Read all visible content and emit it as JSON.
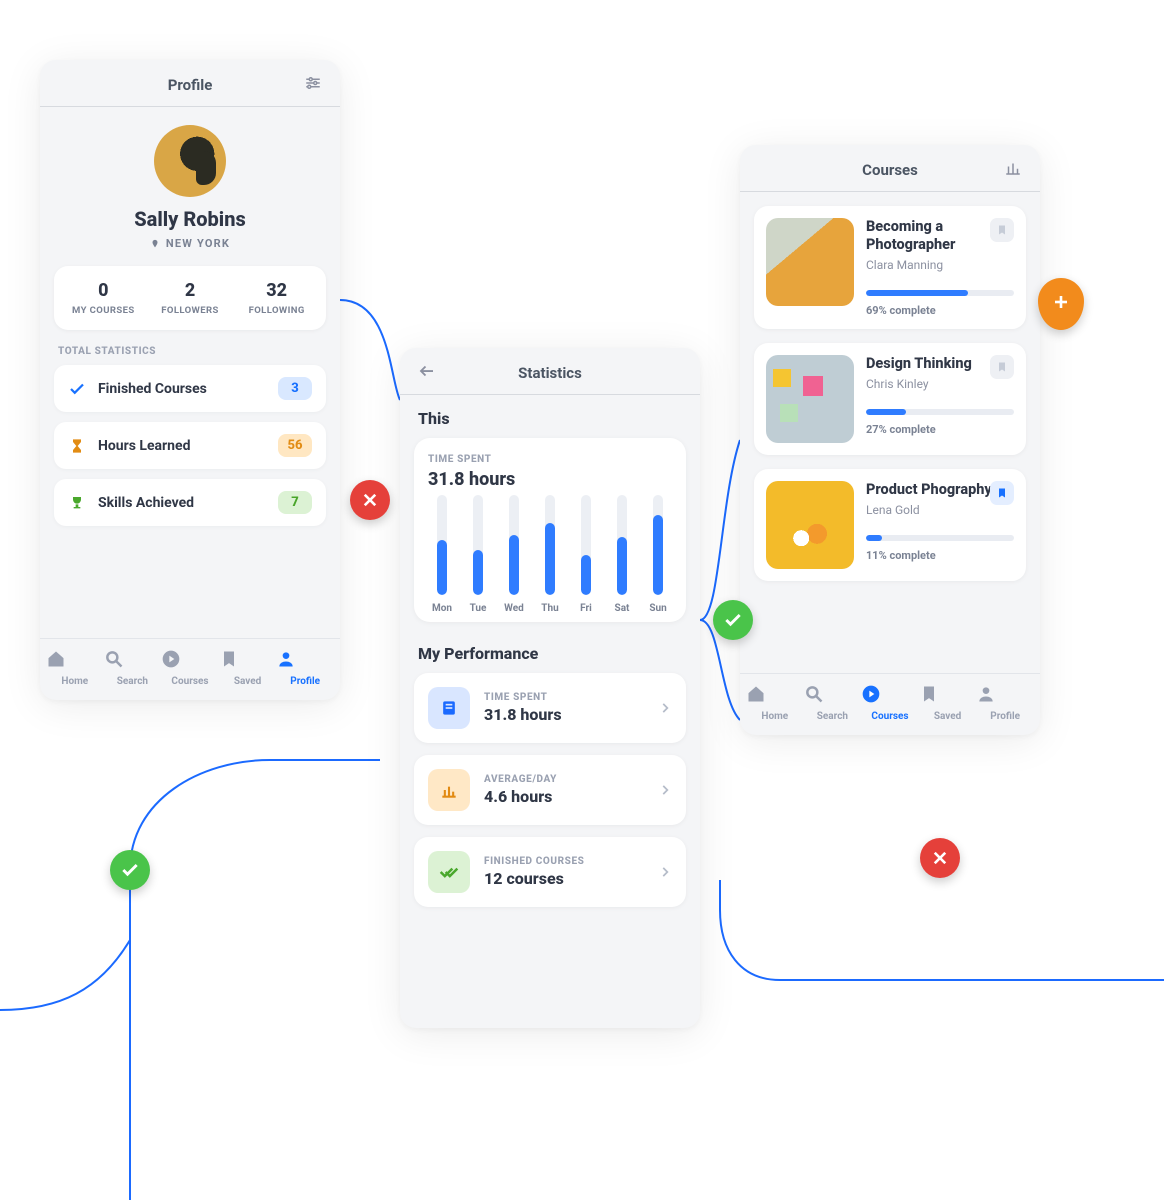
{
  "profile": {
    "headerTitle": "Profile",
    "name": "Sally Robins",
    "location": "NEW YORK",
    "stats": [
      {
        "value": "0",
        "label": "MY COURSES"
      },
      {
        "value": "2",
        "label": "FOLLOWERS"
      },
      {
        "value": "32",
        "label": "FOLLOWING"
      }
    ],
    "totalStatsLabel": "TOTAL STATISTICS",
    "rows": [
      {
        "label": "Finished Courses",
        "badge": "3"
      },
      {
        "label": "Hours Learned",
        "badge": "56"
      },
      {
        "label": "Skills Achieved",
        "badge": "7"
      }
    ],
    "tabs": [
      "Home",
      "Search",
      "Courses",
      "Saved",
      "Profile"
    ],
    "activeTab": "Profile"
  },
  "statistics": {
    "headerTitle": "Statistics",
    "thisLabel": "This",
    "timeSpentLabel": "TIME SPENT",
    "timeSpentValue": "31.8 hours",
    "days": [
      "Mon",
      "Tue",
      "Wed",
      "Thu",
      "Fri",
      "Sat",
      "Sun"
    ],
    "perfHeader": "My Performance",
    "perf": [
      {
        "label": "TIME SPENT",
        "value": "31.8 hours"
      },
      {
        "label": "AVERAGE/DAY",
        "value": "4.6 hours"
      },
      {
        "label": "FINISHED COURSES",
        "value": "12 courses"
      }
    ]
  },
  "courses": {
    "headerTitle": "Courses",
    "items": [
      {
        "title": "Becoming a Photographer",
        "author": "Clara Manning",
        "percent": 69,
        "percentLabel": "69% complete",
        "saved": false
      },
      {
        "title": "Design Thinking",
        "author": "Chris Kinley",
        "percent": 27,
        "percentLabel": "27% complete",
        "saved": false
      },
      {
        "title": "Product Phography",
        "author": "Lena Gold",
        "percent": 11,
        "percentLabel": "11% complete",
        "saved": true
      }
    ],
    "tabs": [
      "Home",
      "Search",
      "Courses",
      "Saved",
      "Profile"
    ],
    "activeTab": "Courses"
  },
  "chart_data": {
    "type": "bar",
    "categories": [
      "Mon",
      "Tue",
      "Wed",
      "Thu",
      "Fri",
      "Sat",
      "Sun"
    ],
    "values": [
      55,
      45,
      60,
      72,
      40,
      58,
      80
    ],
    "title": "TIME SPENT",
    "ylabel": "",
    "xlabel": "",
    "ylim": [
      0,
      100
    ]
  }
}
